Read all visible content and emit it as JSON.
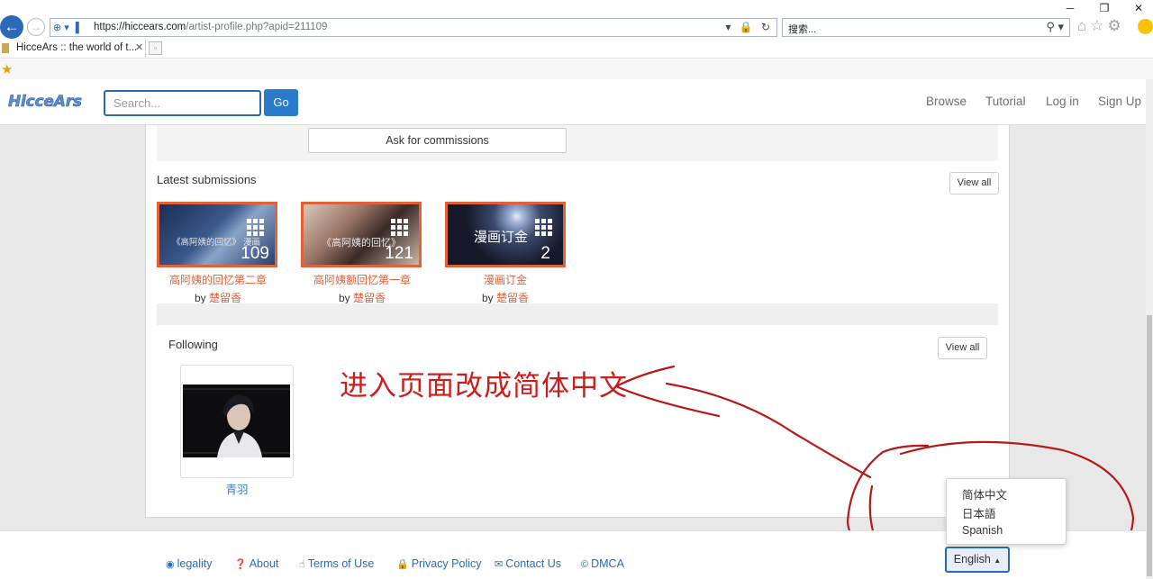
{
  "window": {
    "minimize": "─",
    "restore": "❐",
    "close": "✕"
  },
  "browser": {
    "url_host": "https://hiccears.com",
    "url_path": "/artist-profile.php?apid=211109",
    "search_placeholder": "搜索...",
    "tab_title": "HicceArs :: the world of t...",
    "tab_close": "✕"
  },
  "site": {
    "logo": "HicceArs",
    "search_placeholder": "Search...",
    "go_label": "Go",
    "nav": [
      "Browse",
      "Tutorial",
      "Log in",
      "Sign Up"
    ]
  },
  "profile": {
    "commission_label": "Ask for commissions",
    "latest_title": "Latest submissions",
    "view_all": "View all",
    "submissions": [
      {
        "title": "高阿姨的回忆第二章",
        "count": "109",
        "by": "by",
        "author": "楚留香",
        "thumb_text": "《高阿姨的回忆》 漫画"
      },
      {
        "title": "高阿姨额回忆第一章",
        "count": "121",
        "by": "by",
        "author": "楚留香",
        "thumb_text": "《高阿姨的回忆》"
      },
      {
        "title": "漫画订金",
        "count": "2",
        "by": "by",
        "author": "楚留香",
        "thumb_text": "漫画订金"
      }
    ],
    "following_title": "Following",
    "following_view_all": "View all",
    "following": [
      {
        "name": "青羽"
      }
    ]
  },
  "annotation": {
    "text": "进入页面改成简体中文"
  },
  "footer": {
    "links": [
      "legality",
      "About",
      "Terms of Use",
      "Privacy Policy",
      "Contact Us",
      "DMCA"
    ],
    "lang_button": "English",
    "lang_options": [
      "简体中文",
      "日本語",
      "Spanish"
    ]
  },
  "colors": {
    "accent": "#2a7bc9",
    "submission": "#e0613a",
    "annotation": "#cc1d1d"
  }
}
